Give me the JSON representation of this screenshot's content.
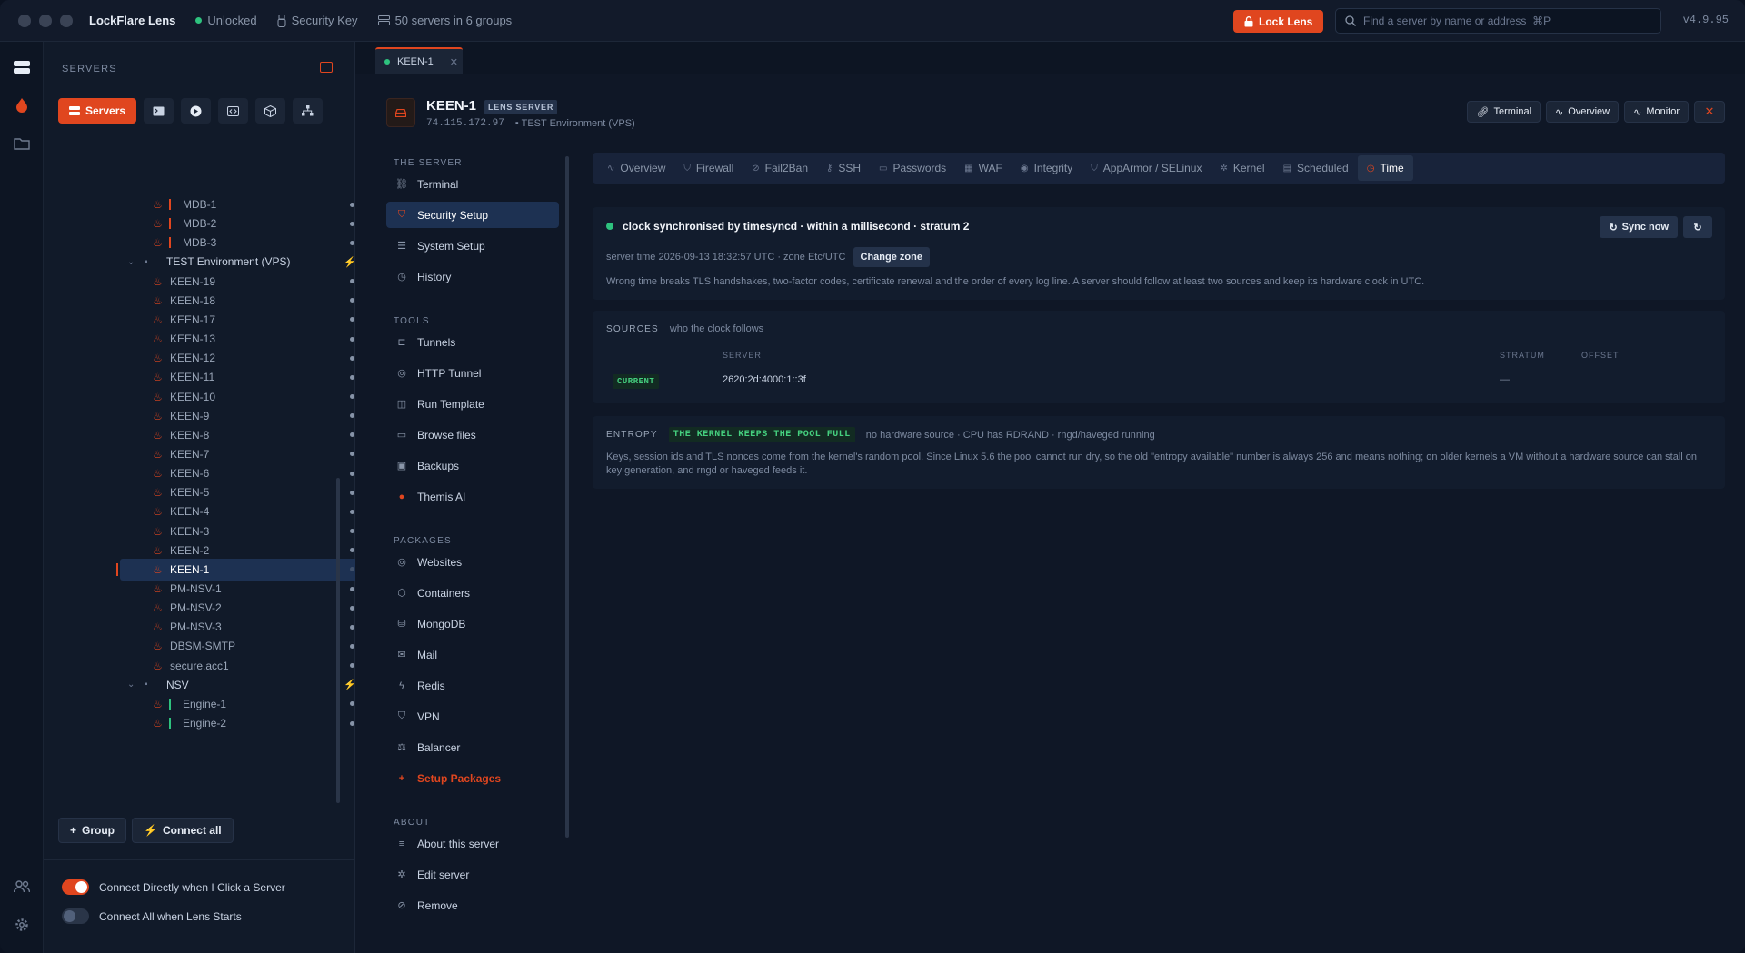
{
  "titlebar": {
    "app_name": "LockFlare Lens",
    "status": "Unlocked",
    "security_key": "Security Key",
    "servers_count": "50 servers in 6 groups",
    "lock_button": "Lock Lens",
    "search_placeholder": "Find a server by name or address  ⌘P",
    "version": "v4.9.95"
  },
  "sidebar": {
    "heading": "SERVERS",
    "tabs": {
      "servers": "Servers"
    },
    "tree": {
      "mdb": [
        "MDB-1",
        "MDB-2",
        "MDB-3"
      ],
      "test_group": "TEST Environment (VPS)",
      "test_servers": [
        "KEEN-19",
        "KEEN-18",
        "KEEN-17",
        "KEEN-13",
        "KEEN-12",
        "KEEN-11",
        "KEEN-10",
        "KEEN-9",
        "KEEN-8",
        "KEEN-7",
        "KEEN-6",
        "KEEN-5",
        "KEEN-4",
        "KEEN-3",
        "KEEN-2",
        "KEEN-1",
        "PM-NSV-1",
        "PM-NSV-2",
        "PM-NSV-3",
        "DBSM-SMTP",
        "secure.acc1"
      ],
      "nsv_group": "NSV",
      "nsv_servers": [
        "Engine-1",
        "Engine-2"
      ]
    },
    "group_button": "Group",
    "connect_all_button": "Connect all",
    "toggle_connect_direct": "Connect Directly when I Click a Server",
    "toggle_connect_start": "Connect All when Lens Starts"
  },
  "main": {
    "open_tab": "KEEN-1",
    "server": {
      "name": "KEEN-1",
      "badge": "LENS SERVER",
      "ip": "74.115.172.97",
      "group": "TEST Environment (VPS)"
    },
    "header_buttons": {
      "terminal": "Terminal",
      "overview": "Overview",
      "monitor": "Monitor"
    },
    "nav": {
      "section_server": "THE SERVER",
      "server_items": [
        "Terminal",
        "Security Setup",
        "System Setup",
        "History"
      ],
      "section_tools": "TOOLS",
      "tool_items": [
        "Tunnels",
        "HTTP Tunnel",
        "Run Template",
        "Browse files",
        "Backups",
        "Themis AI"
      ],
      "section_packages": "PACKAGES",
      "package_items": [
        "Websites",
        "Containers",
        "MongoDB",
        "Mail",
        "Redis",
        "VPN",
        "Balancer",
        "Setup Packages"
      ],
      "section_about": "ABOUT",
      "about_items": [
        "About this server",
        "Edit server",
        "Remove"
      ]
    },
    "security_tabs": [
      "Overview",
      "Firewall",
      "Fail2Ban",
      "SSH",
      "Passwords",
      "WAF",
      "Integrity",
      "AppArmor / SELinux",
      "Kernel",
      "Scheduled",
      "Time"
    ],
    "time": {
      "status": "clock synchronised by timesyncd · within a millisecond · stratum 2",
      "server_time": "server time 2026-09-13 18:32:57 UTC · zone Etc/UTC",
      "change_zone": "Change zone",
      "sync_now": "Sync now",
      "note": "Wrong time breaks TLS handshakes, two-factor codes, certificate renewal and the order of every log line. A server should follow at least two sources and keep its hardware clock in UTC."
    },
    "sources": {
      "label": "SOURCES",
      "sub": "who the clock follows",
      "columns": [
        "SERVER",
        "STRATUM",
        "OFFSET"
      ],
      "rows": [
        {
          "state": "CURRENT",
          "server": "2620:2d:4000:1::3f",
          "stratum": "—",
          "offset": ""
        }
      ]
    },
    "entropy": {
      "label": "ENTROPY",
      "pill": "THE KERNEL KEEPS THE POOL FULL",
      "status": "no hardware source · CPU has RDRAND · rngd/haveged running",
      "text": "Keys, session ids and TLS nonces come from the kernel's random pool. Since Linux 5.6 the pool cannot run dry, so the old \"entropy available\" number is always 256 and means nothing; on older kernels a VM without a hardware source can stall on key generation, and rngd or haveged feeds it."
    }
  },
  "colors": {
    "accent": "#e0461f",
    "ok": "#2ec27e",
    "bg": "#0f1726"
  }
}
